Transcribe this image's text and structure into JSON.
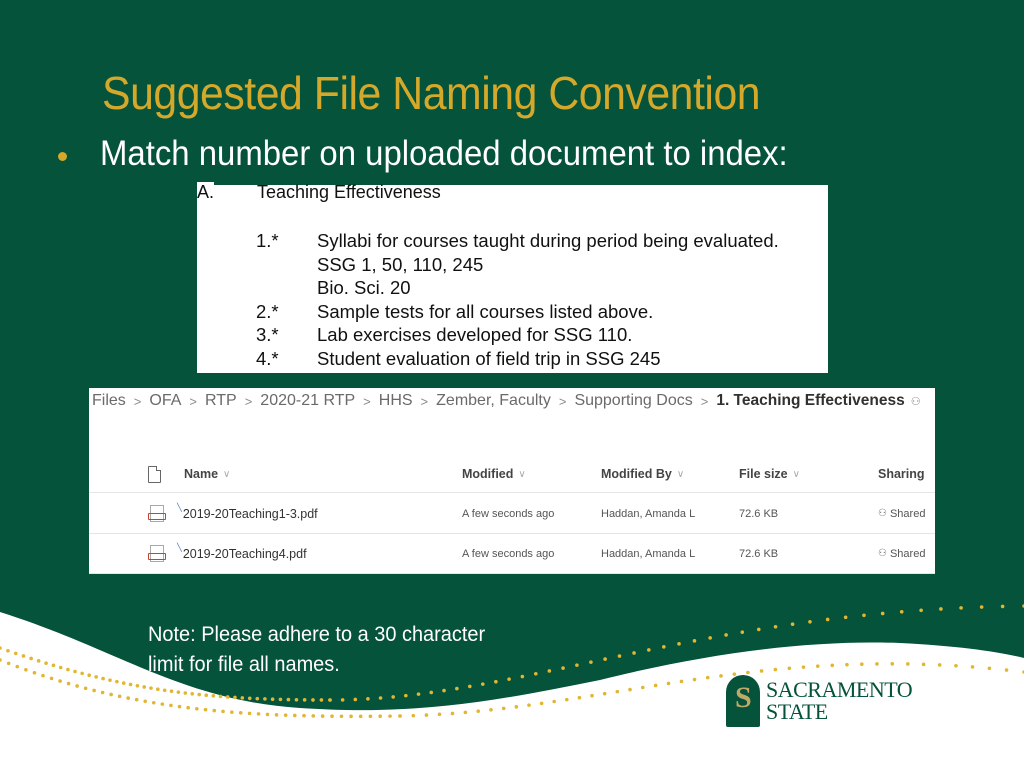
{
  "slide": {
    "title": "Suggested File Naming Convention",
    "bullet": "Match number on uploaded document to index:",
    "colors": {
      "background": "#04533a",
      "accent_gold": "#d4a82a",
      "text_white": "#ffffff"
    }
  },
  "index_excerpt": {
    "section_letter": "A.",
    "section_title": "Teaching Effectiveness",
    "items": [
      {
        "num": "1.*",
        "text": "Syllabi for courses taught during period being evaluated."
      },
      {
        "num": "",
        "text": "SSG 1, 50, 110, 245"
      },
      {
        "num": "",
        "text": "Bio. Sci. 20"
      },
      {
        "num": "2.*",
        "text": "Sample tests for all courses listed above."
      },
      {
        "num": "3.*",
        "text": "Lab exercises developed for SSG 110."
      },
      {
        "num": "4.*",
        "text": "Student evaluation of field trip in SSG 245"
      }
    ]
  },
  "file_browser": {
    "breadcrumb": [
      "Files",
      "OFA",
      "RTP",
      "2020-21 RTP",
      "HHS",
      "Zember, Faculty",
      "Supporting Docs",
      "1. Teaching Effectiveness"
    ],
    "breadcrumb_separator": ">",
    "columns": {
      "type_icon": "document-icon",
      "name": "Name",
      "modified": "Modified",
      "modified_by": "Modified By",
      "file_size": "File size",
      "sharing": "Sharing"
    },
    "sort_chevron": "∨",
    "rows": [
      {
        "icon": "pdf-icon",
        "name": "2019-20Teaching1-3.pdf",
        "modified": "A few seconds ago",
        "modified_by": "Haddan, Amanda L",
        "file_size": "72.6 KB",
        "sharing": "Shared"
      },
      {
        "icon": "pdf-icon",
        "name": "2019-20Teaching4.pdf",
        "modified": "A few seconds ago",
        "modified_by": "Haddan, Amanda L",
        "file_size": "72.6 KB",
        "sharing": "Shared"
      }
    ]
  },
  "note": {
    "line1": "Note: Please adhere to a 30 character",
    "line2": "limit for file all names."
  },
  "logo": {
    "line1": "SACRAMENTO",
    "line2": "STATE"
  }
}
